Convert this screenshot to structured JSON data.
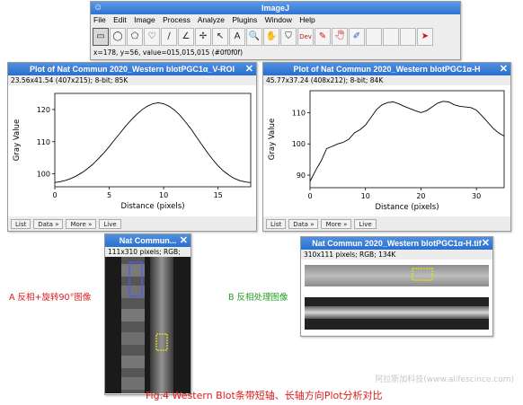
{
  "imagej": {
    "title": "ImageJ",
    "app_icon": "☺",
    "menu": [
      "File",
      "Edit",
      "Image",
      "Process",
      "Analyze",
      "Plugins",
      "Window",
      "Help"
    ],
    "tools": [
      "▭",
      "◯",
      "⬠",
      "♡",
      "∕",
      "∠",
      "✢",
      "↖",
      "A",
      "🔍",
      "✋",
      "⛉",
      "Dev",
      "✎",
      "🖑",
      "✐",
      "",
      "",
      "",
      "➤"
    ],
    "status": "x=178, y=56, value=015,015,015 (#0f0f0f)"
  },
  "plot_left": {
    "title": "Plot of Nat Commun 2020_Western blotPGC1α_V-ROI",
    "info": "23.56x41.54  (407x215); 8-bit; 85K",
    "buttons": [
      "List",
      "Data »",
      "More »",
      "Live"
    ],
    "chart_data": {
      "type": "line",
      "xlabel": "Distance (pixels)",
      "ylabel": "Gray Value",
      "xlim": [
        0,
        18
      ],
      "ylim": [
        96,
        125
      ],
      "xticks": [
        0,
        5,
        10,
        15
      ],
      "yticks": [
        100,
        110,
        120
      ],
      "x": [
        0,
        0.5,
        1,
        1.5,
        2,
        2.5,
        3,
        3.5,
        4,
        4.5,
        5,
        5.5,
        6,
        6.5,
        7,
        7.5,
        8,
        8.5,
        9,
        9.5,
        10,
        10.5,
        11,
        11.5,
        12,
        12.5,
        13,
        13.5,
        14,
        14.5,
        15,
        15.5,
        16,
        16.5,
        17,
        17.5,
        18
      ],
      "y": [
        97.3,
        97.6,
        98,
        98.6,
        99.4,
        100.4,
        101.6,
        103,
        104.7,
        106.5,
        108.5,
        110.6,
        112.7,
        114.8,
        116.7,
        118.4,
        119.9,
        121,
        121.8,
        122.1,
        121.8,
        121,
        119.8,
        118.2,
        116.2,
        114,
        111.6,
        109.1,
        106.7,
        104.5,
        102.5,
        100.9,
        99.6,
        98.6,
        97.9,
        97.5,
        97.3
      ]
    }
  },
  "plot_right": {
    "title": "Plot of Nat Commun 2020_Western blotPGC1α-H",
    "info": "45.77x37.24  (408x212); 8-bit; 84K",
    "buttons": [
      "List",
      "Data »",
      "More »",
      "Live"
    ],
    "chart_data": {
      "type": "line",
      "xlabel": "Distance (pixels)",
      "ylabel": "Gray Value",
      "xlim": [
        0,
        35
      ],
      "ylim": [
        86,
        117
      ],
      "xticks": [
        0,
        10,
        20,
        30
      ],
      "yticks": [
        90,
        100,
        110
      ],
      "x": [
        0,
        1,
        2,
        3,
        4,
        5,
        6,
        7,
        8,
        9,
        10,
        11,
        12,
        13,
        14,
        15,
        16,
        17,
        18,
        19,
        20,
        21,
        22,
        23,
        24,
        25,
        26,
        27,
        28,
        29,
        30,
        31,
        32,
        33,
        34,
        35
      ],
      "y": [
        88,
        91.5,
        94.5,
        98.5,
        99.2,
        100,
        100.5,
        101.5,
        103.5,
        104.5,
        106,
        108.5,
        111,
        112.5,
        113.2,
        113.4,
        112.8,
        112,
        111.3,
        110.6,
        110,
        110.6,
        111.8,
        113,
        113.6,
        113.4,
        112.5,
        112,
        111.8,
        111.6,
        110.8,
        109,
        107,
        105,
        103.5,
        102.5
      ]
    }
  },
  "blot_left": {
    "title": "Nat Commun...",
    "info": "111x310 pixels; RGB;"
  },
  "blot_right": {
    "title": "Nat Commun 2020_Western blotPGC1α-H.tif",
    "info": "310x111 pixels; RGB; 134K"
  },
  "captions": {
    "left": "A 反相+旋转90°图像",
    "right": "B 反相处理图像",
    "figure": "Fig.4 Western Blot条带短轴、长轴方向Plot分析对比",
    "watermark": "阿拉斯加科技(www.alifescince.com)"
  },
  "close_symbol": "✕",
  "colors": {
    "titlebar": "#2a6fd0",
    "caption_red": "#e01a1a",
    "caption_green": "#22a022",
    "roi_blue": "#4a5cff",
    "roi_yellow": "#e6e600"
  }
}
